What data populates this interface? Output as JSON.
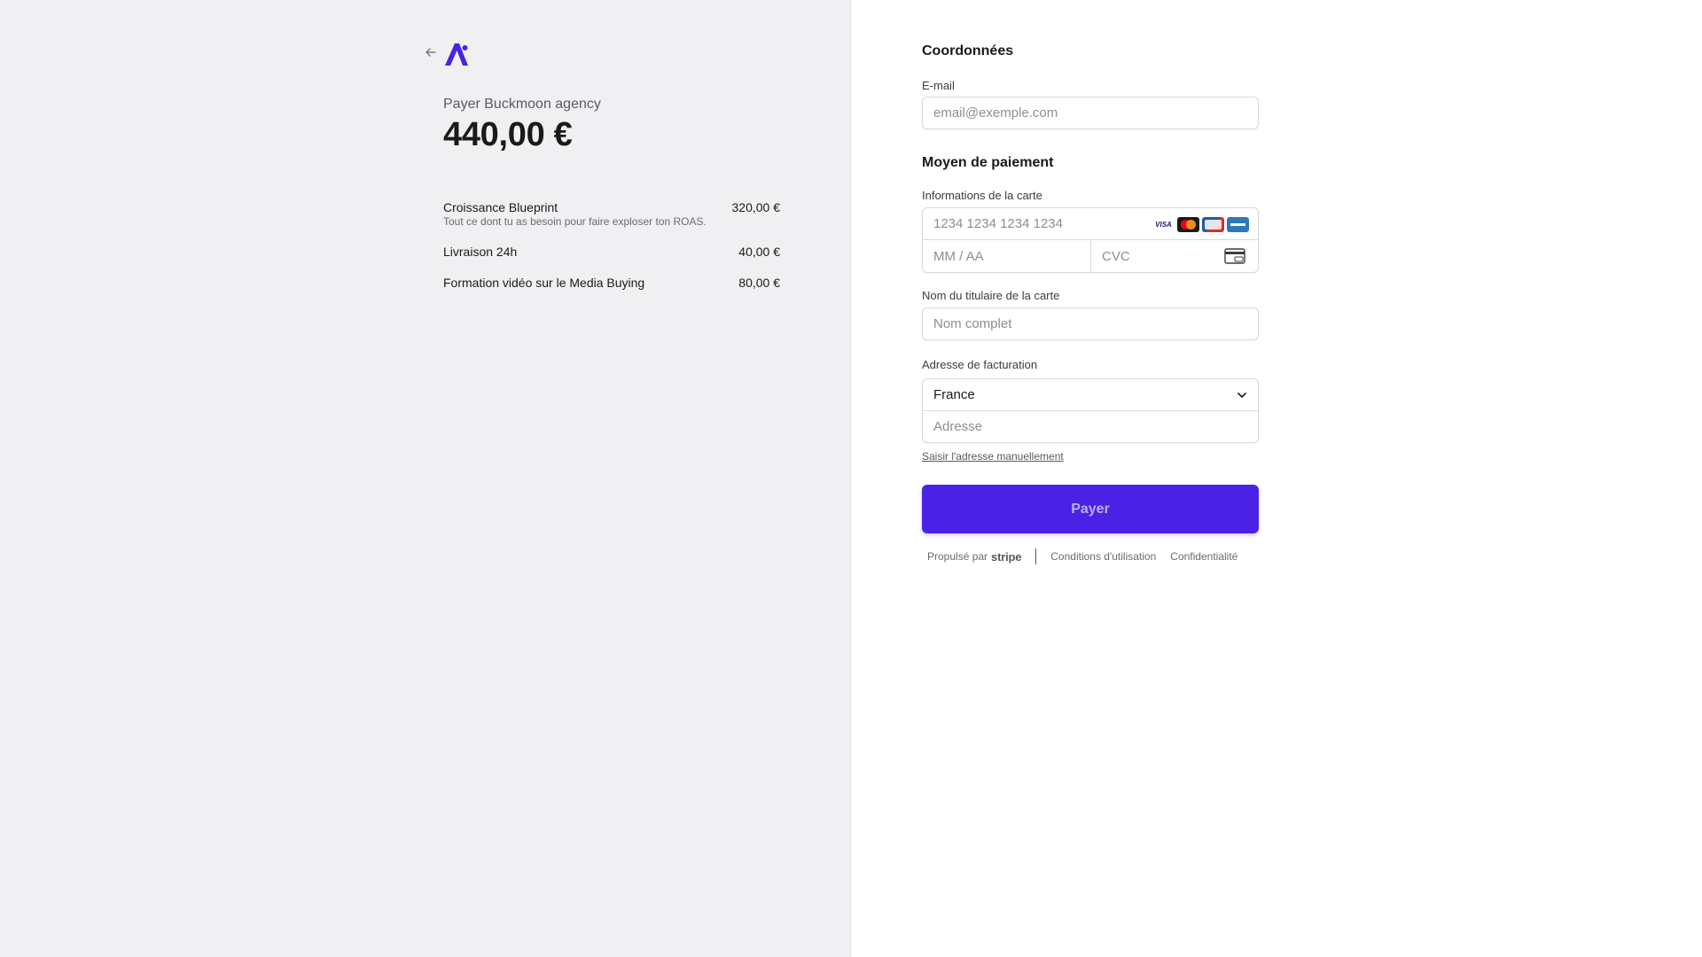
{
  "summary": {
    "merchant_label": "Payer Buckmoon agency",
    "total": "440,00 €",
    "items": [
      {
        "name": "Croissance Blueprint",
        "price": "320,00 €",
        "description": "Tout ce dont tu as besoin pour faire exploser ton ROAS."
      },
      {
        "name": "Livraison 24h",
        "price": "40,00 €",
        "description": ""
      },
      {
        "name": "Formation vidéo sur le Media Buying",
        "price": "80,00 €",
        "description": ""
      }
    ]
  },
  "contact": {
    "section_title": "Coordonnées",
    "email_label": "E-mail",
    "email_placeholder": "email@exemple.com"
  },
  "payment": {
    "section_title": "Moyen de paiement",
    "card_label": "Informations de la carte",
    "card_number_placeholder": "1234 1234 1234 1234",
    "expiry_placeholder": "MM / AA",
    "cvc_placeholder": "CVC",
    "brands": [
      "visa-icon",
      "mastercard-icon",
      "cartes-bancaires-icon",
      "amex-icon"
    ],
    "brand_visa_text": "VISA",
    "cardholder_label": "Nom du titulaire de la carte",
    "cardholder_placeholder": "Nom complet",
    "billing_label": "Adresse de facturation",
    "country": "France",
    "address_placeholder": "Adresse",
    "manual_address_link": "Saisir l'adresse manuellement",
    "pay_button": "Payer"
  },
  "footer": {
    "powered_by": "Propulsé par",
    "stripe": "stripe",
    "terms": "Conditions d'utilisation",
    "privacy": "Confidentialité"
  },
  "colors": {
    "accent": "#4a22e6",
    "left_background": "#f0f0f2"
  }
}
